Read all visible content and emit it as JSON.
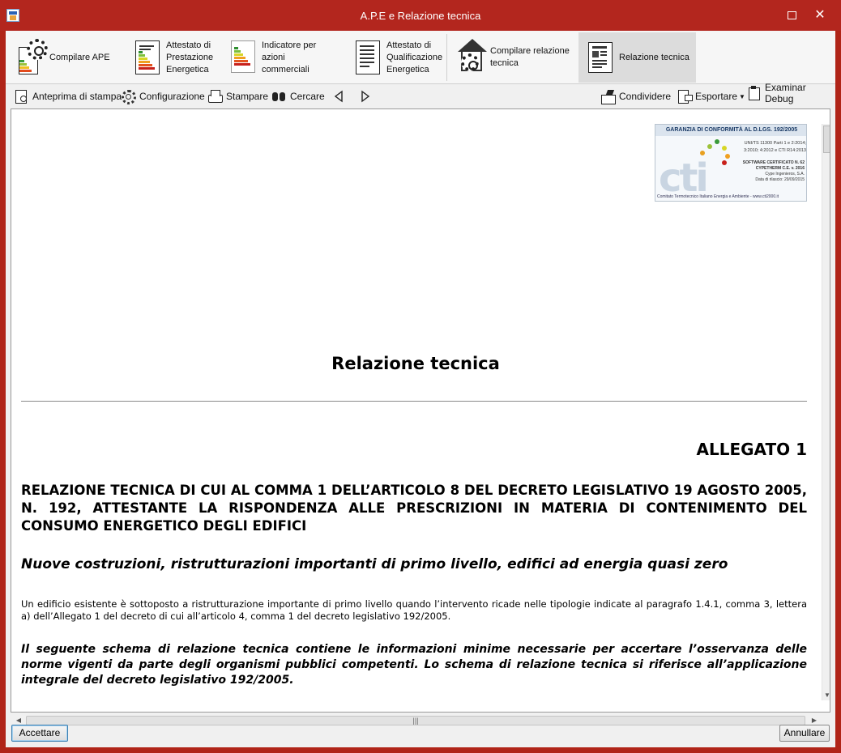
{
  "window": {
    "title": "A.P.E e Relazione tecnica",
    "accent_color": "#b3261e"
  },
  "ribbon": {
    "items": [
      {
        "label": "Compilare APE",
        "icon": "ape-gear-doc-icon"
      },
      {
        "label": "Attestato di\nPrestazione\nEnergetica",
        "icon": "energy-certificate-icon"
      },
      {
        "label": "Indicatore per\nazioni commerciali",
        "icon": "energy-indicator-icon"
      },
      {
        "label": "Attestato di\nQualificazione\nEnergetica",
        "icon": "qualification-doc-icon"
      },
      {
        "label": "Compilare relazione\ntecnica",
        "icon": "house-gear-icon"
      },
      {
        "label": "Relazione tecnica",
        "icon": "report-doc-icon",
        "active": true
      }
    ]
  },
  "toolbar": {
    "preview": "Anteprima di stampa",
    "config": "Configurazione",
    "print": "Stampare",
    "search": "Cercare",
    "share": "Condividere",
    "export": "Esportare",
    "debug": "Examinar Debug"
  },
  "document": {
    "badge": {
      "header": "GARANZIA DI CONFORMITÀ AL D.LGS. 192/2005",
      "norms": "UNI/TS 11300 Parti 1 e 2:2014; 3:2010; 4:2012 e CTI R14:2013",
      "cert_no": "SOFTWARE CERTIFICATO N. 62",
      "product": "CYPETHERM C.E. v. 2016",
      "company": "Cype Ingenieros, S.A.",
      "date": "Data di rilascio: 29/09/2015",
      "logo": "cti",
      "footer": "Comitato Termotecnico Italiano Energia e Ambiente - www.cti2000.it"
    },
    "title": "Relazione tecnica",
    "allegato": "ALLEGATO 1",
    "heading": "RELAZIONE TECNICA DI CUI AL COMMA 1 DELL’ARTICOLO 8 DEL DECRETO LEGISLATIVO 19 AGOSTO 2005, N. 192, ATTESTANTE LA RISPONDENZA ALLE PRESCRIZIONI IN MATERIA DI CONTENIMENTO DEL CONSUMO ENERGETICO DEGLI EDIFICI",
    "subheading": "Nuove costruzioni, ristrutturazioni importanti di primo livello, edifici ad energia quasi zero",
    "paragraph": "Un edificio esistente è sottoposto a ristrutturazione importante di primo livello quando l’intervento ricade nelle tipologie indicate al paragrafo 1.4.1, comma 3, lettera a) dell’Allegato 1 del decreto di cui all’articolo 4, comma 1 del decreto legislativo 192/2005.",
    "italic_paragraph": "Il seguente schema di relazione tecnica contiene le informazioni minime necessarie per accertare l’osservanza delle norme vigenti da parte degli organismi pubblici competenti. Lo schema di relazione tecnica si riferisce all’applicazione integrale del decreto legislativo 192/2005."
  },
  "footer": {
    "accept": "Accettare",
    "cancel": "Annullare"
  }
}
